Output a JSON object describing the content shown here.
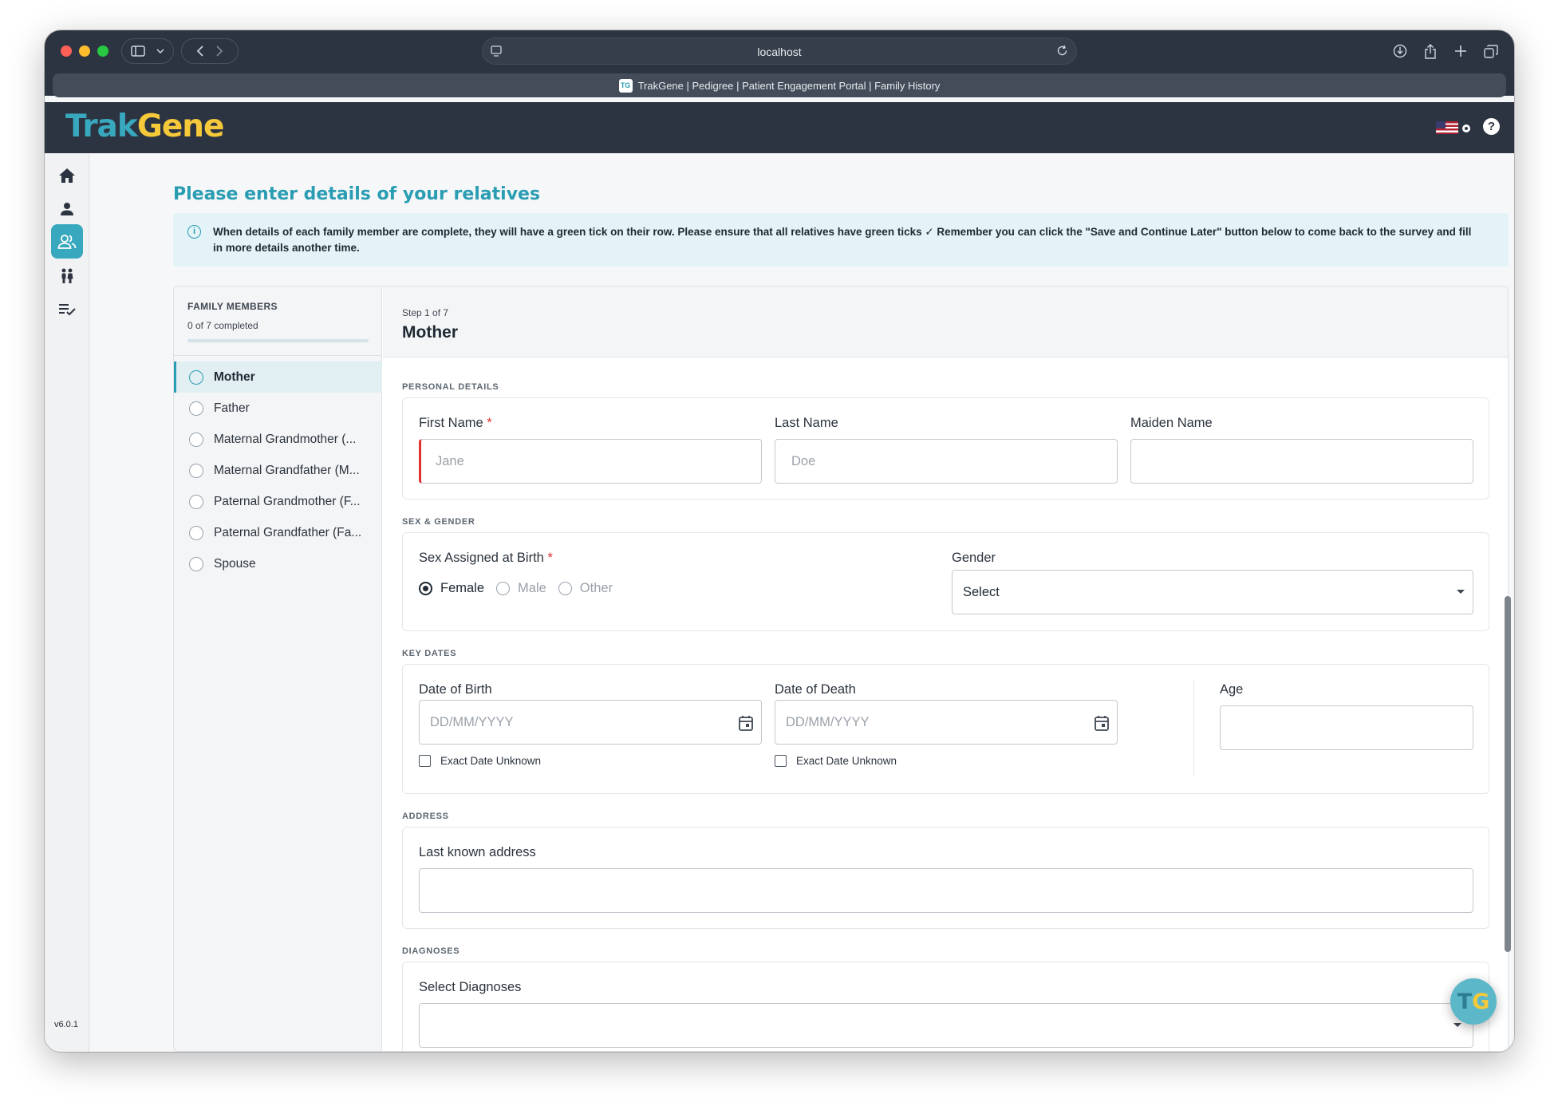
{
  "browser": {
    "url": "localhost",
    "tab_title": "TrakGene | Pedigree | Patient Engagement Portal | Family History",
    "favicon_text": "TG"
  },
  "app": {
    "logo_part1": "Trak",
    "logo_part2": "Gene",
    "help_label": "?",
    "version": "v6.0.1",
    "fab_part1": "T",
    "fab_part2": "G"
  },
  "rail": {
    "items": [
      {
        "icon": "home-icon",
        "active": false
      },
      {
        "icon": "person-icon",
        "active": false
      },
      {
        "icon": "group-icon",
        "active": true
      },
      {
        "icon": "family-icon",
        "active": false
      },
      {
        "icon": "checklist-icon",
        "active": false
      }
    ]
  },
  "page": {
    "title": "Please enter details of your relatives",
    "info": "When details of each family member are complete, they will have a green tick on their row. Please ensure that all relatives have green ticks ✓ Remember you can click the \"Save and Continue Later\" button below to come back to the survey and fill in more details another time.",
    "info_icon": "i"
  },
  "members": {
    "heading": "FAMILY MEMBERS",
    "count": "0 of 7 completed",
    "completed_fraction": 0,
    "items": [
      {
        "label": "Mother",
        "active": true
      },
      {
        "label": "Father",
        "active": false
      },
      {
        "label": "Maternal Grandmother (...",
        "active": false
      },
      {
        "label": "Maternal Grandfather (M...",
        "active": false
      },
      {
        "label": "Paternal Grandmother (F...",
        "active": false
      },
      {
        "label": "Paternal Grandfather (Fa...",
        "active": false
      },
      {
        "label": "Spouse",
        "active": false
      }
    ]
  },
  "form": {
    "step": "Step 1 of 7",
    "member_title": "Mother",
    "sections": {
      "personal": "PERSONAL DETAILS",
      "sex_gender": "SEX & GENDER",
      "key_dates": "KEY DATES",
      "address": "ADDRESS",
      "diagnoses": "DIAGNOSES"
    },
    "personal": {
      "first_name_label": "First Name",
      "required_mark": "*",
      "first_name_placeholder": "Jane",
      "last_name_label": "Last Name",
      "last_name_placeholder": "Doe",
      "maiden_name_label": "Maiden Name",
      "maiden_name_value": ""
    },
    "sex": {
      "label": "Sex Assigned at Birth",
      "options": [
        {
          "label": "Female",
          "checked": true
        },
        {
          "label": "Male",
          "checked": false
        },
        {
          "label": "Other",
          "checked": false
        }
      ],
      "gender_label": "Gender",
      "gender_value": "Select"
    },
    "dates": {
      "dob_label": "Date of Birth",
      "dob_placeholder": "DD/MM/YYYY",
      "dod_label": "Date of Death",
      "dod_placeholder": "DD/MM/YYYY",
      "unknown_label": "Exact Date Unknown",
      "age_label": "Age",
      "age_value": ""
    },
    "address": {
      "label": "Last known address",
      "value": ""
    },
    "diagnoses": {
      "label": "Select Diagnoses",
      "value": ""
    }
  },
  "colors": {
    "accent": "#2a9db3",
    "header": "#2d3441",
    "required": "#e03131",
    "logo_yellow": "#f5c93a"
  }
}
